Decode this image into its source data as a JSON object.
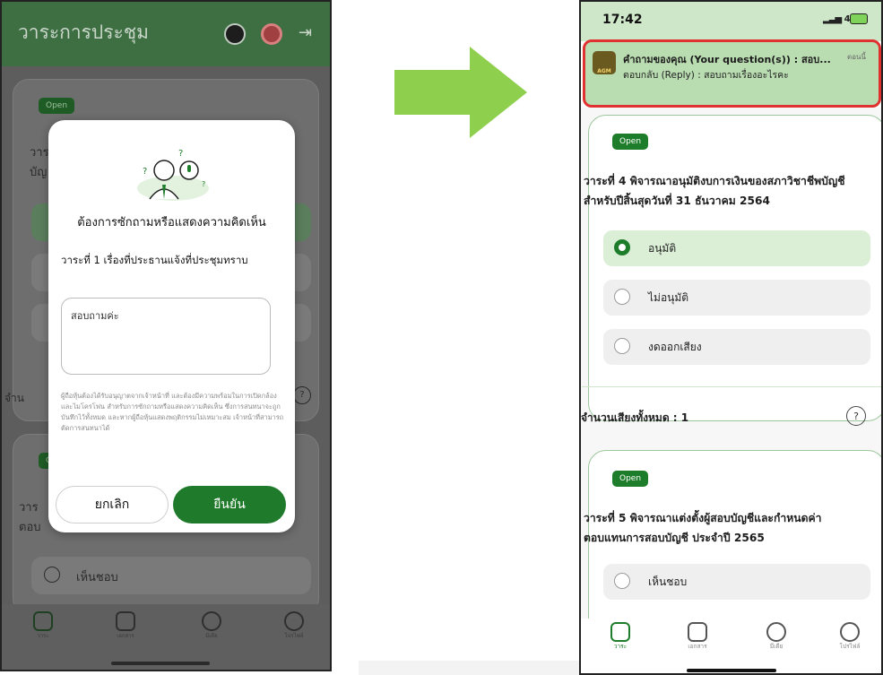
{
  "left_screen": {
    "header_title": "วาระการประชุม",
    "card1": {
      "badge": "Open",
      "partial_lines": [
        "วาร",
        "บัญ"
      ]
    },
    "votes_partial": "จำน",
    "card2": {
      "badge": "O",
      "partial_lines": [
        "วาร",
        "ตอบ"
      ]
    },
    "option_approve": "เห็นชอบ",
    "modal": {
      "title": "ต้องการซักถามหรือแสดงความคิดเห็น",
      "agenda": "วาระที่ 1 เรื่องที่ประธานแจ้งที่ประชุมทราบ",
      "textarea_value": "สอบถามค่ะ",
      "note": "ผู้ถือหุ้นต้องได้รับอนุญาตจากเจ้าหน้าที่ และต้องมีความพร้อมในการเปิดกล้องและไมโครโฟน สำหรับการซักถามหรือแสดงความคิดเห็น ซึ่งการสนทนาจะถูกบันทึกไว้ทั้งหมด และหากผู้ถือหุ้นแสดงพฤติกรรมไม่เหมาะสม เจ้าหน้าที่สามารถตัดการสนทนาได้",
      "cancel": "ยกเลิก",
      "confirm": "ยืนยัน"
    },
    "nav": [
      "วาระ",
      "เอกสาร",
      "มีเดีย",
      "โปรไฟล์"
    ]
  },
  "right_screen": {
    "status": {
      "time": "17:42",
      "network": "4G"
    },
    "notification": {
      "line1": "คำถามของคุณ (Your question(s)) : สอบ...",
      "line2": "ตอบกลับ (Reply) : สอบถามเรื่องอะไรคะ",
      "time": "ตอนนี้",
      "logo_text": "AGM"
    },
    "card1": {
      "badge": "Open",
      "agenda": "วาระที่ 4 พิจารณาอนุมัติงบการเงินของสภาวิชาชีพบัญชี สำหรับปีสิ้นสุดวันที่ 31 ธันวาคม 2564",
      "options": [
        "อนุมัติ",
        "ไม่อนุมัติ",
        "งดออกเสียง"
      ],
      "selected_index": 0,
      "votes_label": "จำนวนเสียงทั้งหมด : 1",
      "help": "?"
    },
    "card2": {
      "badge": "Open",
      "agenda": "วาระที่ 5 พิจารณาแต่งตั้งผู้สอบบัญชีและกำหนดค่าตอบแทนการสอบบัญชี ประจำปี 2565",
      "option1": "เห็นชอบ"
    },
    "nav": [
      "วาระ",
      "เอกสาร",
      "มีเดีย",
      "โปรไฟล์"
    ]
  },
  "colors": {
    "brand_green": "#1e7d2a",
    "notification_border": "#e03030",
    "arrow": "#8fcf4e"
  }
}
